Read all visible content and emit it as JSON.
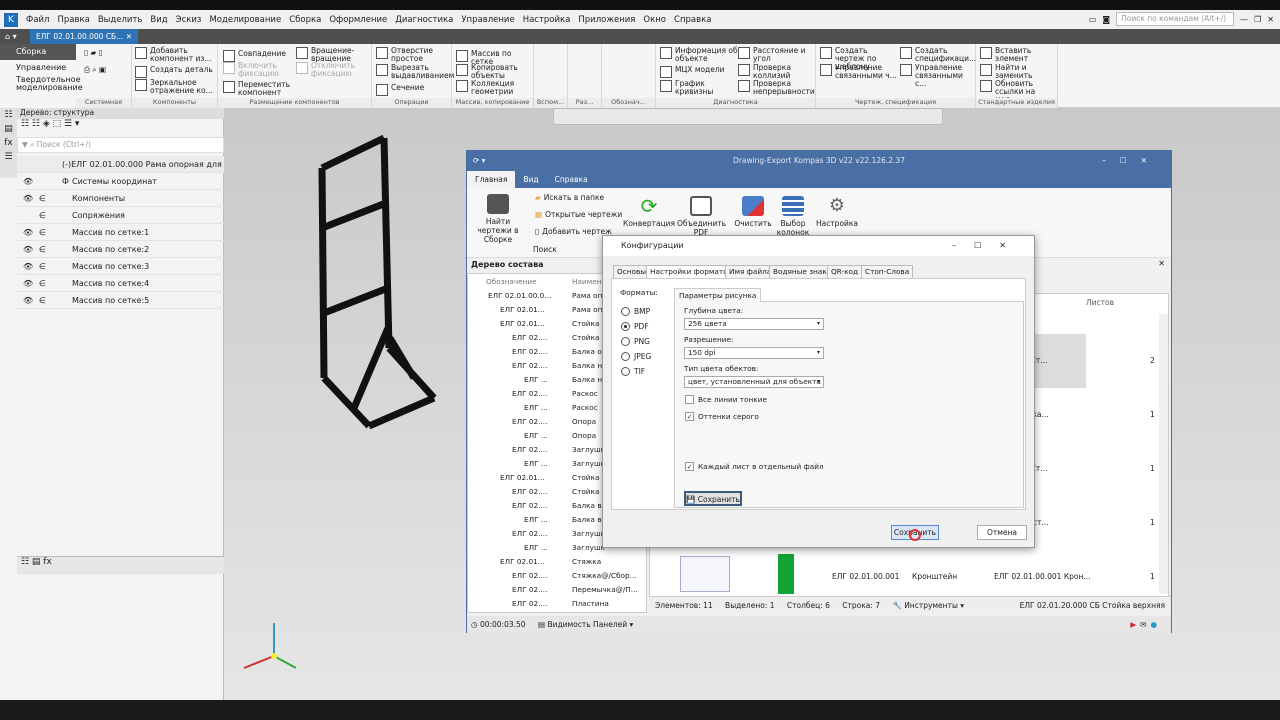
{
  "app": {
    "menu": [
      "Файл",
      "Правка",
      "Выделить",
      "Вид",
      "Эскиз",
      "Моделирование",
      "Сборка",
      "Оформление",
      "Диагностика",
      "Управление",
      "Настройка",
      "Приложения",
      "Окно",
      "Справка"
    ],
    "search_placeholder": "Поиск по командам (Alt+/)",
    "doc_tab": "ЕЛГ 02.01.00.000 СБ..."
  },
  "side_modes": [
    "Сборка",
    "Управление",
    "Твердотельное моделирование"
  ],
  "ribbon": {
    "groups": [
      {
        "cap": "Системная"
      },
      {
        "cap": "Компоненты",
        "items": [
          "Добавить компонент из...",
          "Создать деталь",
          "Зеркальное отражение ко..."
        ]
      },
      {
        "cap": "Размещение компонентов",
        "items": [
          "Совпадение",
          "Включить фиксацию",
          "Переместить компонент",
          "Вращение-вращение",
          "Отключить фиксацию"
        ]
      },
      {
        "cap": "Операции",
        "items": [
          "Отверстие простое",
          "Вырезать выдавливанием",
          "Сечение"
        ]
      },
      {
        "cap": "Массив, копирование",
        "items": [
          "Массив по сетке",
          "Копировать объекты",
          "Коллекция геометрии"
        ]
      },
      {
        "cap": "Вспом..."
      },
      {
        "cap": "Раз..."
      },
      {
        "cap": "Обознач..."
      },
      {
        "cap": "Диагностика",
        "items": [
          "Информация об объекте",
          "МЦХ модели",
          "График кривизны",
          "Расстояние и угол",
          "Проверка коллизий",
          "Проверка непрерывности"
        ]
      },
      {
        "cap": "Чертеж, спецификация",
        "items": [
          "Создать чертеж по шаблону",
          "Управление связанными ч...",
          "Создать спецификаци...",
          "Управление связанными с..."
        ]
      },
      {
        "cap": "Стандартные изделия",
        "items": [
          "Вставить элемент",
          "Найти и заменить",
          "Обновить ссылки на мод..."
        ]
      }
    ]
  },
  "tree": {
    "title": "Дерево: структура",
    "search_placeholder": "Поиск (Ctrl+/)",
    "root": "(-)ЕЛГ 02.01.00.000 Рама опорная для Ф",
    "rows": [
      "Системы координат",
      "Компоненты",
      "Сопряжения",
      "Массив по сетке:1",
      "Массив по сетке:2",
      "Массив по сетке:3",
      "Массив по сетке:4",
      "Массив по сетке:5"
    ]
  },
  "de": {
    "title": "Drawing-Export Kompas 3D v22 v22.126.2.37",
    "tabs": [
      "Главная",
      "Вид",
      "Справка"
    ],
    "search_group": [
      "Найти чертежи в Сборке",
      "Искать в папке",
      "Открытые чертежи",
      "Добавить чертеж",
      "Поиск"
    ],
    "buttons": [
      "Конвертация",
      "Объединить PDF",
      "Очистить",
      "Выбор колонок",
      "Настройка"
    ],
    "tree_title": "Дерево состава",
    "cols": [
      "Обозначение",
      "Наименование"
    ],
    "tree_rows": [
      [
        "ЕЛГ 02.01.00.0...",
        "Рама опо"
      ],
      [
        "ЕЛГ 02.01...",
        "Рама опо"
      ],
      [
        "ЕЛГ 02.01...",
        "Стойка н"
      ],
      [
        "ЕЛГ 02....",
        "Стойка н"
      ],
      [
        "ЕЛГ 02....",
        "Балка оп"
      ],
      [
        "ЕЛГ 02....",
        "Балка ни"
      ],
      [
        "ЕЛГ ...",
        "Балка ни"
      ],
      [
        "ЕЛГ 02....",
        "Раскос"
      ],
      [
        "ЕЛГ ...",
        "Раскос"
      ],
      [
        "ЕЛГ 02....",
        "Опора"
      ],
      [
        "ЕЛГ ...",
        "Опора"
      ],
      [
        "ЕЛГ 02....",
        "Заглушк"
      ],
      [
        "ЕЛГ ...",
        "Заглушк"
      ],
      [
        "ЕЛГ 02.01...",
        "Стойка в"
      ],
      [
        "ЕЛГ 02....",
        "Стойка в"
      ],
      [
        "ЕЛГ 02....",
        "Балка ве"
      ],
      [
        "ЕЛГ ...",
        "Балка ве"
      ],
      [
        "ЕЛГ 02....",
        "Заглушк"
      ],
      [
        "ЕЛГ ...",
        "Заглушк"
      ],
      [
        "ЕЛГ 02.01...",
        "Стяжка"
      ],
      [
        "ЕЛГ 02....",
        "Стяжка@/Сбор..."
      ],
      [
        "ЕЛГ 02....",
        "Перемычка@/П..."
      ],
      [
        "ЕЛГ 02....",
        "Пластина"
      ]
    ],
    "grid_header": "Листов",
    "grid_rows": [
      [
        "0.000 СБ Ст...",
        "2"
      ],
      [
        "0.001 Балка...",
        "1"
      ],
      [
        "0.000 СБ Ст...",
        "1"
      ],
      [
        "0.002 Пласт...",
        "1"
      ],
      [
        "ЕЛГ 02.01.00.001",
        "Кронштейн",
        "ЕЛГ 02.01.00.001 Крон...",
        "1"
      ]
    ],
    "status": {
      "elements": "Элементов:  11",
      "selected": "Выделено:  1",
      "col": "Столбец:  6",
      "row": "Строка:  7",
      "tools": "Инструменты",
      "right": "ЕЛГ 02.01.20.000 СБ Стойка верхняя"
    },
    "timer": "00:00:03.50",
    "panels": "Видимость Панелей"
  },
  "cfg": {
    "title": "Конфигурации",
    "tabs": [
      "Основы",
      "Настройки форматов",
      "Имя файла",
      "Водяные знаки",
      "QR-код",
      "Стоп-Слова"
    ],
    "formats_label": "Форматы:",
    "formats": [
      "BMP",
      "PDF",
      "PNG",
      "JPEG",
      "TIF"
    ],
    "selected_format": "PDF",
    "subtab": "Параметры рисунка",
    "depth_label": "Глубина цвета:",
    "depth": "256 цвета",
    "res_label": "Разрешение:",
    "res": "150 dpi",
    "ctype_label": "Тип цвета обектов:",
    "ctype": "цвет, установленный для объекта",
    "thin": "Все линии тонкие",
    "gray": "Оттенки серого",
    "each": "Каждый лист в отдельный файл",
    "save_inner": "Сохранить",
    "save": "Сохранить",
    "cancel": "Отмена"
  },
  "colors": {
    "accent": "#4a6fa5",
    "kompas": "#2e74b5"
  }
}
